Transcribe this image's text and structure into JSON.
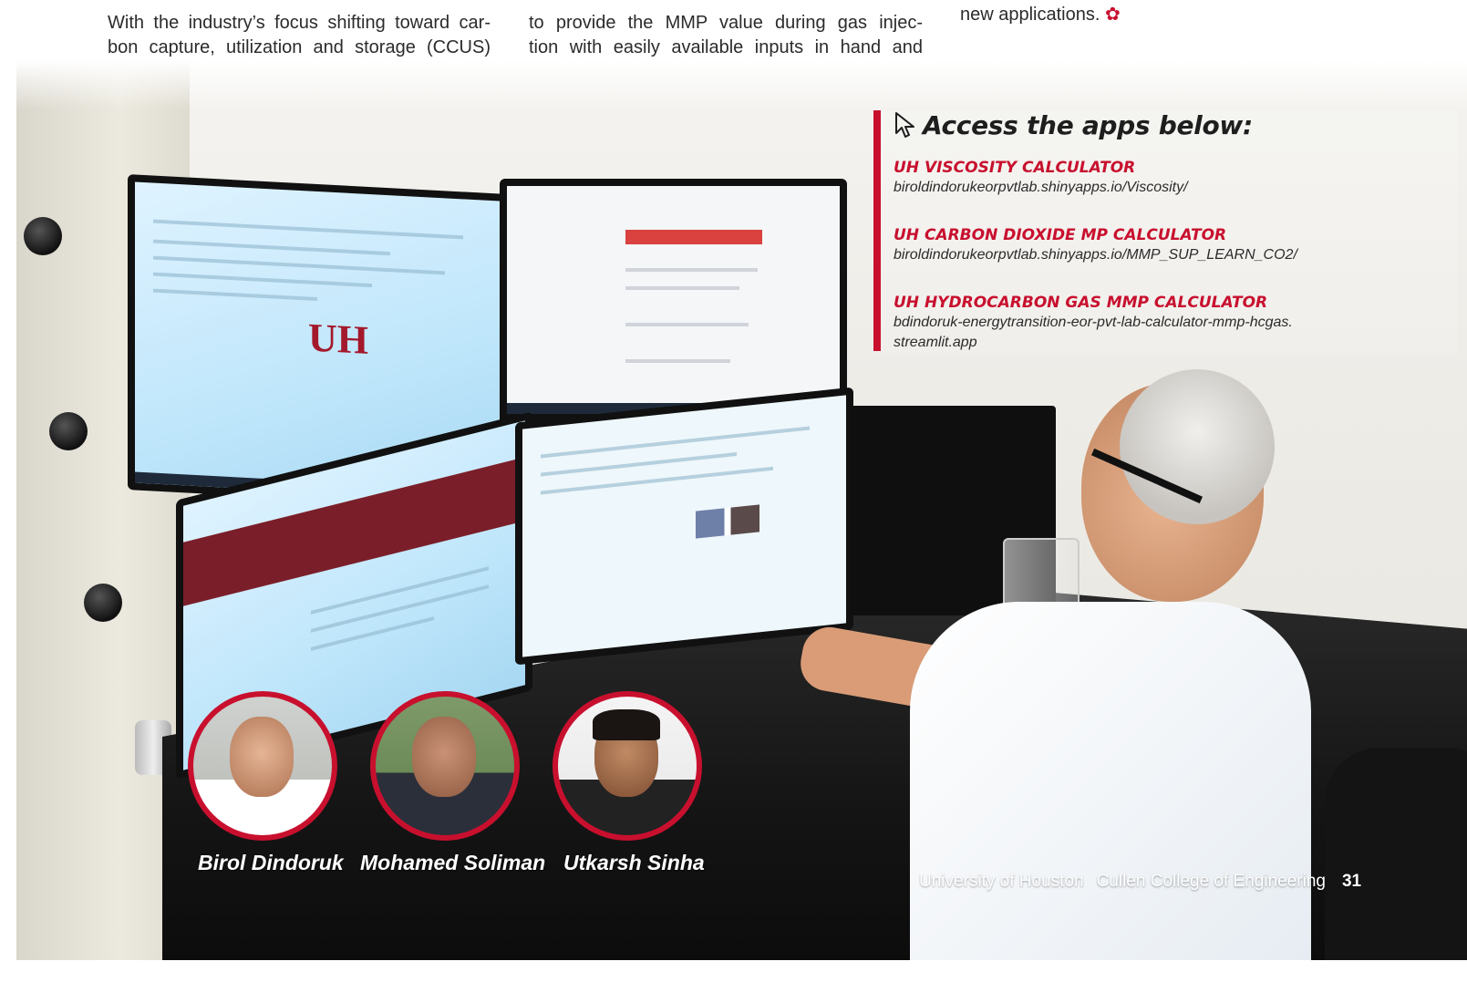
{
  "article": {
    "col1_lines": [
      "With the industry’s focus shifting toward car-",
      "bon capture, utilization and storage (CCUS)"
    ],
    "col2_lines": [
      "to provide the MMP value during gas injec-",
      "tion with easily available inputs in hand and"
    ],
    "col3_lines": [
      "new applications."
    ]
  },
  "sidebar": {
    "heading": "Access the apps below:",
    "apps": [
      {
        "title": "UH VISCOSITY CALCULATOR",
        "url": "biroldindorukeorpvtlab.shinyapps.io/Viscosity/"
      },
      {
        "title": "UH CARBON DIOXIDE MP CALCULATOR",
        "url": "biroldindorukeorpvtlab.shinyapps.io/MMP_SUP_LEARN_CO2/"
      },
      {
        "title": "UH HYDROCARBON GAS MMP CALCULATOR",
        "url_lines": [
          "bdindoruk-energytransition-eor-pvt-lab-calculator-mmp-hcgas.",
          "streamlit.app"
        ]
      }
    ]
  },
  "people": [
    {
      "name": "Birol Dindoruk"
    },
    {
      "name": "Mohamed Soliman"
    },
    {
      "name": "Utkarsh Sinha"
    }
  ],
  "photo": {
    "monitor_logo": "UH"
  },
  "footer": {
    "university": "University of Houston",
    "college": "Cullen College of Engineering",
    "page_number": "31"
  },
  "colors": {
    "accent": "#c8102e"
  },
  "icons": [
    "cursor-arrow-icon",
    "cougar-paw-icon"
  ]
}
